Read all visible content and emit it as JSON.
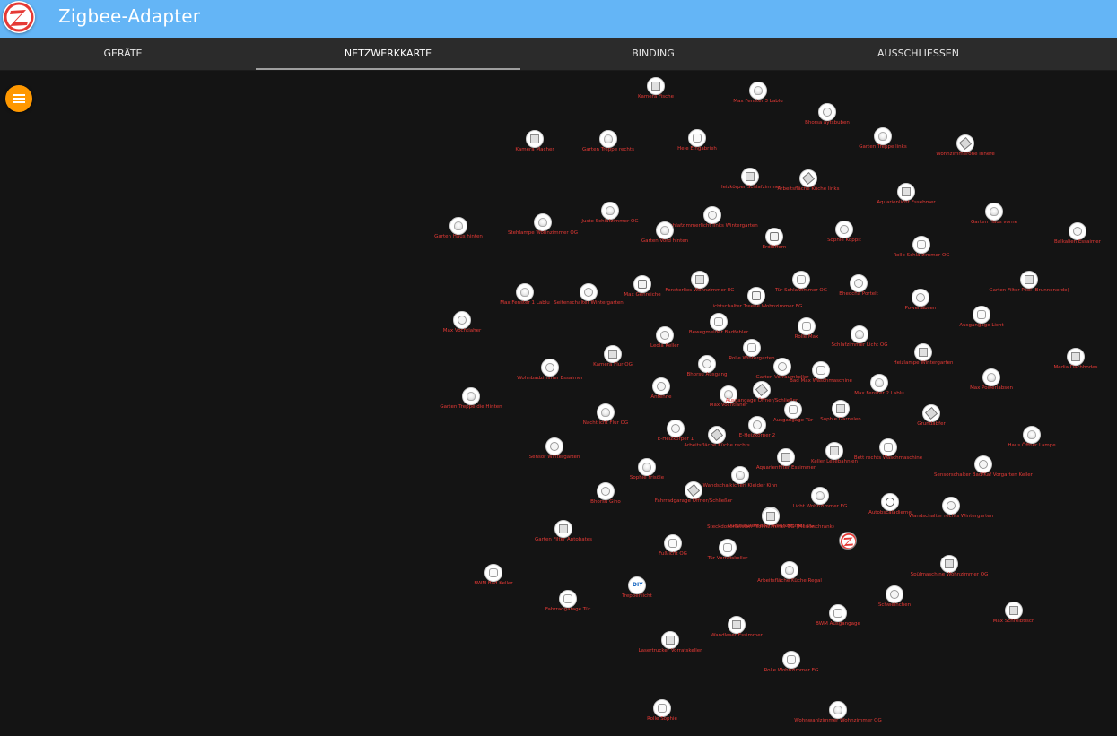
{
  "header": {
    "title": "Zigbee-Adapter"
  },
  "tabs": [
    {
      "label": "GERÄTE",
      "active": false
    },
    {
      "label": "NETZWERKKARTE",
      "active": true
    },
    {
      "label": "BINDING",
      "active": false
    },
    {
      "label": "AUSSCHLIESSEN",
      "active": false
    }
  ],
  "colors": {
    "accent": "#64b5f6",
    "menu": "#ff9800",
    "label": "#e53935",
    "background": "#141414"
  },
  "map": {
    "nodes": [
      {
        "label": "Kamera Fische",
        "icon": "box-icon"
      },
      {
        "label": "Max Fenster 3 Lablu",
        "icon": "bulb-icon"
      },
      {
        "label": "Bhorsa aytsbuben",
        "icon": "plug-icon"
      },
      {
        "label": "Kamera Macher",
        "icon": "box-icon"
      },
      {
        "label": "Garten Treppe rechts",
        "icon": "bulb-icon"
      },
      {
        "label": "Hele Eingabrieh",
        "icon": "sensor-icon"
      },
      {
        "label": "Garten Treppe links",
        "icon": "bulb-icon"
      },
      {
        "label": "Wohnzimmeröhe Innere",
        "icon": "strip-icon"
      },
      {
        "label": "Heizkörper Schlafzimmer",
        "icon": "box-icon"
      },
      {
        "label": "Arbeitsfläche Küche links",
        "icon": "strip-icon"
      },
      {
        "label": "Aquarienlicht Essebmer",
        "icon": "box-icon"
      },
      {
        "label": "Garten Haus hinten",
        "icon": "bulb-icon"
      },
      {
        "label": "Stehlampe Wohnzimmer OG",
        "icon": "bulb-icon"
      },
      {
        "label": "Juste Schlafzimmer OG",
        "icon": "bulb-icon"
      },
      {
        "label": "Schlafzimmerlicht links Wintergarten",
        "icon": "plug-icon"
      },
      {
        "label": "Garten Vord hinten",
        "icon": "bulb-icon"
      },
      {
        "label": "Erdlöffern",
        "icon": "remote-icon"
      },
      {
        "label": "Sophie Koppit",
        "icon": "plug-icon"
      },
      {
        "label": "Garten Haus vorne",
        "icon": "bulb-icon"
      },
      {
        "label": "Balkalien Essaimer",
        "icon": "plug-icon"
      },
      {
        "label": "Rolle Schlafzimmer OG",
        "icon": "sensor-icon"
      },
      {
        "label": "Max Fenster 1 Lablu",
        "icon": "bulb-icon"
      },
      {
        "label": "Seitenschalter Wintergarten",
        "icon": "plug-icon"
      },
      {
        "label": "Max Genreiche",
        "icon": "remote-icon"
      },
      {
        "label": "Fensterlies Wohnzimmer EG",
        "icon": "box-icon"
      },
      {
        "label": "Lichtschalter Treene Wohnzimmer EG",
        "icon": "remote-icon"
      },
      {
        "label": "Tür Schlafzimmer OG",
        "icon": "sensor-icon"
      },
      {
        "label": "Bheocha Portelt",
        "icon": "plug-icon"
      },
      {
        "label": "Garten Filter Pool (Brunnenerde)",
        "icon": "box-icon"
      },
      {
        "label": "Powerlabsen",
        "icon": "plug-icon"
      },
      {
        "label": "Ausgangage Licht",
        "icon": "sensor-icon"
      },
      {
        "label": "Max Vochtlaher",
        "icon": "plug-icon"
      },
      {
        "label": "Bewegmelder Badfehler",
        "icon": "sensor-icon"
      },
      {
        "label": "Ledla Keller",
        "icon": "plug-icon"
      },
      {
        "label": "Rolle Max",
        "icon": "sensor-icon"
      },
      {
        "label": "Schlafzimmer Licht OG",
        "icon": "bulb-icon"
      },
      {
        "label": "Heizlampe Wintergarten",
        "icon": "box-icon"
      },
      {
        "label": "Media Dachbodes",
        "icon": "box-icon"
      },
      {
        "label": "Wohnbadzimmer Essaimer",
        "icon": "plug-icon"
      },
      {
        "label": "Kamera Flur OG",
        "icon": "box-icon"
      },
      {
        "label": "Bhorsu Ausgang",
        "icon": "plug-icon"
      },
      {
        "label": "Rolle Wintergarten",
        "icon": "sensor-icon"
      },
      {
        "label": "Garten Vorraumkeller",
        "icon": "plug-icon"
      },
      {
        "label": "Bad Max Waschmaschine",
        "icon": "sensor-icon"
      },
      {
        "label": "Max Fenster 2 Lablu",
        "icon": "bulb-icon"
      },
      {
        "label": "Max Powerlabsen",
        "icon": "bulb-icon"
      },
      {
        "label": "Garten Treppe die Hinten",
        "icon": "bulb-icon"
      },
      {
        "label": "Antenne",
        "icon": "plug-icon"
      },
      {
        "label": "Max Vochtlaher",
        "icon": "bulb-icon"
      },
      {
        "label": "Ausgangage Öffner/Schließer",
        "icon": "strip-icon"
      },
      {
        "label": "Nachtlicht Flur OG",
        "icon": "bulb-icon"
      },
      {
        "label": "Ausgangage Tür",
        "icon": "sensor-icon"
      },
      {
        "label": "Sophie Garnelen",
        "icon": "box-icon"
      },
      {
        "label": "Grundabfer",
        "icon": "strip-icon"
      },
      {
        "label": "E-Heizkörper 1",
        "icon": "plug-icon"
      },
      {
        "label": "E-Heizkörper 2",
        "icon": "plug-icon"
      },
      {
        "label": "Arbeitsfläche Küche rechts",
        "icon": "strip-icon"
      },
      {
        "label": "Haus Öffner Lampe",
        "icon": "bulb-icon"
      },
      {
        "label": "Sensor Wintergarten",
        "icon": "plug-icon"
      },
      {
        "label": "Aquarienfilter Essimmer",
        "icon": "box-icon"
      },
      {
        "label": "Keller Lesebahnlen",
        "icon": "box-icon"
      },
      {
        "label": "Bett rechts Waschmaschine",
        "icon": "sensor-icon"
      },
      {
        "label": "Sensorschalter Bad/Kaf Vorgarten Keller",
        "icon": "plug-icon"
      },
      {
        "label": "Durchlauferhitzer Wohnzimmer OG",
        "icon": "box-icon"
      },
      {
        "label": "Sophie Frisöle",
        "icon": "bulb-icon"
      },
      {
        "label": "Wandschalkicheri Kleider Kinn",
        "icon": "bulb-icon"
      },
      {
        "label": "Bhorsu Gino",
        "icon": "plug-icon"
      },
      {
        "label": "Fahrradgarage Öffner/Schließer",
        "icon": "strip-icon"
      },
      {
        "label": "Licht Wohnzimmer EG",
        "icon": "bulb-icon"
      },
      {
        "label": "Autobscaladierne",
        "icon": "tradfri-icon"
      },
      {
        "label": "Wandschalter rechts Wintergarten",
        "icon": "plug-icon"
      },
      {
        "label": "Steckdosenleisten Wohnzimmer EG (Mediaschrank)",
        "icon": "box-icon"
      },
      {
        "label": "Coordinator",
        "icon": "zigbee-icon"
      },
      {
        "label": "Garten Filter Aptobates",
        "icon": "box-icon"
      },
      {
        "label": "Fußlicht OG",
        "icon": "sensor-icon"
      },
      {
        "label": "Tür Vorratskeller",
        "icon": "sensor-icon"
      },
      {
        "label": "BWM Bad Keller",
        "icon": "sensor-icon"
      },
      {
        "label": "Arbeitsfläche Küche Regal",
        "icon": "bulb-icon"
      },
      {
        "label": "Spülmaschine Wohnzimmer OG",
        "icon": "box-icon"
      },
      {
        "label": "Treppenlicht",
        "icon": "diy-icon"
      },
      {
        "label": "Schweinchen",
        "icon": "plug-icon"
      },
      {
        "label": "Fahrradgarage Tür",
        "icon": "sensor-icon"
      },
      {
        "label": "BWM Ausgangage",
        "icon": "sensor-icon"
      },
      {
        "label": "Max Schreibtisch",
        "icon": "box-icon"
      },
      {
        "label": "Wandleser Essimmer",
        "icon": "box-icon"
      },
      {
        "label": "Lasertrucker Vorratskeller",
        "icon": "box-icon"
      },
      {
        "label": "Rolle Wohnzimmer EG",
        "icon": "sensor-icon"
      },
      {
        "label": "Rolle Sophie",
        "icon": "sensor-icon"
      },
      {
        "label": "Wohnwahlzimmer Wohnzimmer OG",
        "icon": "bulb-icon"
      }
    ]
  }
}
